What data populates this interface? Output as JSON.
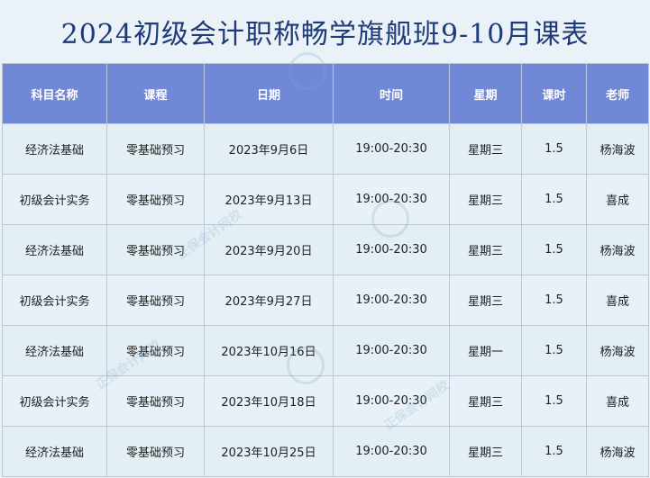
{
  "title": "2024初级会计职称畅学旗舰班9-10月课表",
  "columns": [
    "科目名称",
    "课程",
    "日期",
    "时间",
    "星期",
    "课时",
    "老师"
  ],
  "rows": [
    [
      "经济法基础",
      "零基础预习",
      "2023年9月6日",
      "19:00-20:30",
      "星期三",
      "1.5",
      "杨海波"
    ],
    [
      "初级会计实务",
      "零基础预习",
      "2023年9月13日",
      "19:00-20:30",
      "星期三",
      "1.5",
      "喜成"
    ],
    [
      "经济法基础",
      "零基础预习",
      "2023年9月20日",
      "19:00-20:30",
      "星期三",
      "1.5",
      "杨海波"
    ],
    [
      "初级会计实务",
      "零基础预习",
      "2023年9月27日",
      "19:00-20:30",
      "星期三",
      "1.5",
      "喜成"
    ],
    [
      "经济法基础",
      "零基础预习",
      "2023年10月16日",
      "19:00-20:30",
      "星期一",
      "1.5",
      "杨海波"
    ],
    [
      "初级会计实务",
      "零基础预习",
      "2023年10月18日",
      "19:00-20:30",
      "星期三",
      "1.5",
      "喜成"
    ],
    [
      "经济法基础",
      "零基础预习",
      "2023年10月25日",
      "19:00-20:30",
      "星期三",
      "1.5",
      "杨海波"
    ]
  ],
  "watermark": "正保会计网校"
}
